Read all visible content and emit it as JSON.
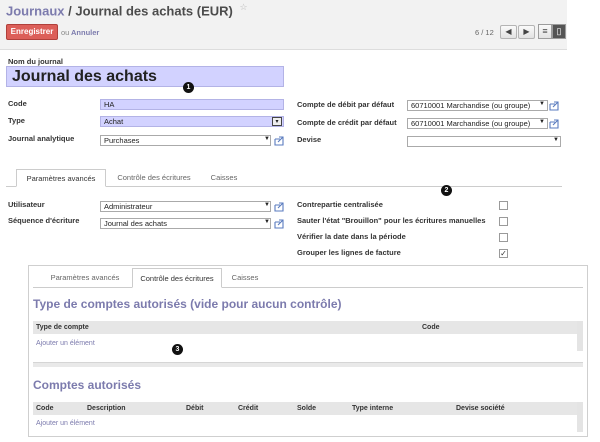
{
  "header": {
    "breadcrumb_parent": "Journaux",
    "breadcrumb_sep": "/",
    "breadcrumb_current": "Journal des achats (EUR)",
    "save_label": "Enregistrer",
    "or_label": "ou",
    "cancel_label": "Annuler",
    "pager": "6 / 12"
  },
  "form": {
    "name_label": "Nom du journal",
    "name_value": "Journal des achats",
    "code_label": "Code",
    "code_value": "HA",
    "type_label": "Type",
    "type_value": "Achat",
    "analytic_label": "Journal analytique",
    "analytic_value": "Purchases",
    "debit_label": "Compte de débit par défaut",
    "debit_value": "60710001 Marchandise (ou groupe)",
    "credit_label": "Compte de crédit par défaut",
    "credit_value": "60710001 Marchandise (ou groupe)",
    "currency_label": "Devise",
    "currency_value": ""
  },
  "tabs": [
    "Paramètres avancés",
    "Contrôle des écritures",
    "Caisses"
  ],
  "advanced": {
    "user_label": "Utilisateur",
    "user_value": "Administrateur",
    "sequence_label": "Séquence d'écriture",
    "sequence_value": "Journal des achats",
    "checkboxes": [
      {
        "label": "Contrepartie centralisée",
        "checked": false
      },
      {
        "label": "Sauter l'état \"Brouillon\" pour les écritures manuelles",
        "checked": false
      },
      {
        "label": "Vérifier la date dans la période",
        "checked": false
      },
      {
        "label": "Grouper les lignes de facture",
        "checked": true
      }
    ]
  },
  "control": {
    "tabs": [
      "Paramètres avancés",
      "Contrôle des écritures",
      "Caisses"
    ],
    "types_title": "Type de comptes autorisés (vide pour aucun contrôle)",
    "types_columns": [
      "Type de compte",
      "Code"
    ],
    "add_item": "Ajouter un élément",
    "accounts_title": "Comptes autorisés",
    "accounts_columns": [
      "Code",
      "Description",
      "Débit",
      "Crédit",
      "Solde",
      "Type interne",
      "Devise société"
    ]
  },
  "callouts": [
    "1",
    "2",
    "3"
  ],
  "icons": {
    "star": "star-icon",
    "prev": "arrow-left-icon",
    "next": "arrow-right-icon",
    "list_view": "list-view-icon",
    "form_view": "form-view-icon",
    "external": "external-link-icon",
    "dropdown": "chevron-down-icon"
  },
  "colors": {
    "primary": "#dc5f59",
    "link": "#7c7bad",
    "required_bg": "#d2d2ff"
  }
}
